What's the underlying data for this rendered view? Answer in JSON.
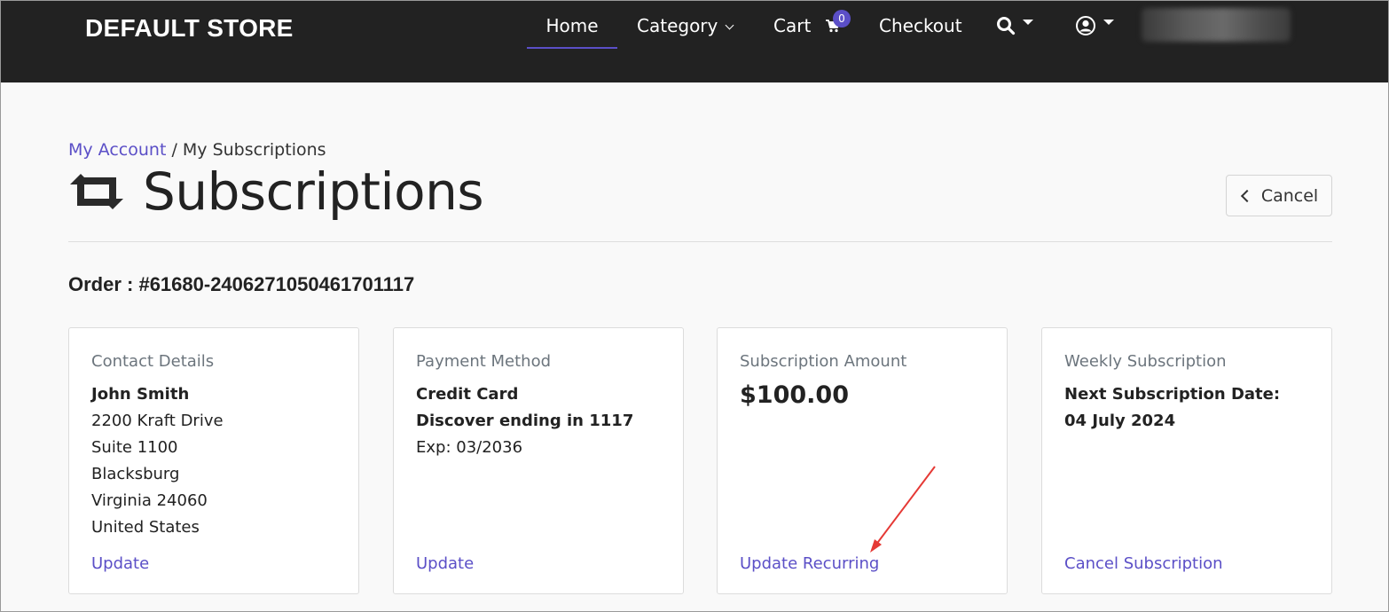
{
  "navbar": {
    "brand": "DEFAULT STORE",
    "items": [
      {
        "label": "Home",
        "active": true
      },
      {
        "label": "Category"
      },
      {
        "label": "Cart",
        "badge": "0"
      },
      {
        "label": "Checkout"
      }
    ],
    "search_icon": "search-icon",
    "user_icon": "user-circle-icon",
    "accent_color": "#5b4fc7",
    "background": "#222222"
  },
  "breadcrumb": {
    "link": "My Account",
    "separator": "/",
    "current": "My Subscriptions"
  },
  "page": {
    "title": "Subscriptions",
    "title_icon": "retweet-icon",
    "cancel_label": "Cancel"
  },
  "order": {
    "heading": "Order : #61680-2406271050461701117"
  },
  "cards": {
    "contact": {
      "title": "Contact Details",
      "name": "John Smith",
      "lines": [
        "2200 Kraft Drive",
        "Suite 1100",
        "Blacksburg",
        "Virginia 24060",
        "United States"
      ],
      "link": "Update"
    },
    "payment": {
      "title": "Payment Method",
      "type": "Credit Card",
      "card": "Discover ending in 1117",
      "exp": "Exp: 03/2036",
      "link": "Update"
    },
    "amount": {
      "title": "Subscription Amount",
      "value": "$100.00",
      "link": "Update Recurring"
    },
    "schedule": {
      "title": "Weekly Subscription",
      "next_label": "Next Subscription Date:",
      "next_date": "04 July 2024",
      "link": "Cancel Subscription"
    }
  },
  "annotation": {
    "arrow_color": "#e53935"
  }
}
